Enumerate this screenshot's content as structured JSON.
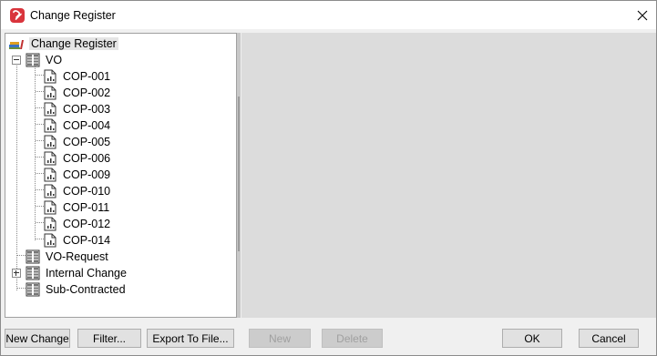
{
  "window": {
    "title": "Change Register"
  },
  "tree": {
    "root": {
      "label": "Change Register",
      "icon": "register-books-icon"
    },
    "groups": [
      {
        "label": "VO",
        "icon": "folder-binder-icon",
        "expanded": true,
        "children": [
          {
            "label": "COP-001",
            "icon": "document-chart-icon"
          },
          {
            "label": "COP-002",
            "icon": "document-chart-icon"
          },
          {
            "label": "COP-003",
            "icon": "document-chart-icon"
          },
          {
            "label": "COP-004",
            "icon": "document-chart-icon"
          },
          {
            "label": "COP-005",
            "icon": "document-chart-icon"
          },
          {
            "label": "COP-006",
            "icon": "document-chart-icon"
          },
          {
            "label": "COP-009",
            "icon": "document-chart-icon"
          },
          {
            "label": "COP-010",
            "icon": "document-chart-icon"
          },
          {
            "label": "COP-011",
            "icon": "document-chart-icon"
          },
          {
            "label": "COP-012",
            "icon": "document-chart-icon"
          },
          {
            "label": "COP-014",
            "icon": "document-chart-icon"
          }
        ]
      },
      {
        "label": "VO-Request",
        "icon": "folder-binder-icon",
        "expanded": false,
        "has_children": false
      },
      {
        "label": "Internal Change",
        "icon": "folder-binder-icon",
        "expanded": false,
        "has_children": true
      },
      {
        "label": "Sub-Contracted",
        "icon": "folder-binder-icon",
        "expanded": false,
        "has_children": false
      }
    ]
  },
  "buttons": {
    "new_change": "New Change",
    "filter": "Filter...",
    "export": "Export To File...",
    "new": "New",
    "delete": "Delete",
    "ok": "OK",
    "cancel": "Cancel"
  },
  "colors": {
    "app_icon": "#d9343c",
    "window_bg": "#f0f0f0",
    "panel_bg": "#dcdcdc",
    "root_highlight": "#e5e5e5"
  }
}
